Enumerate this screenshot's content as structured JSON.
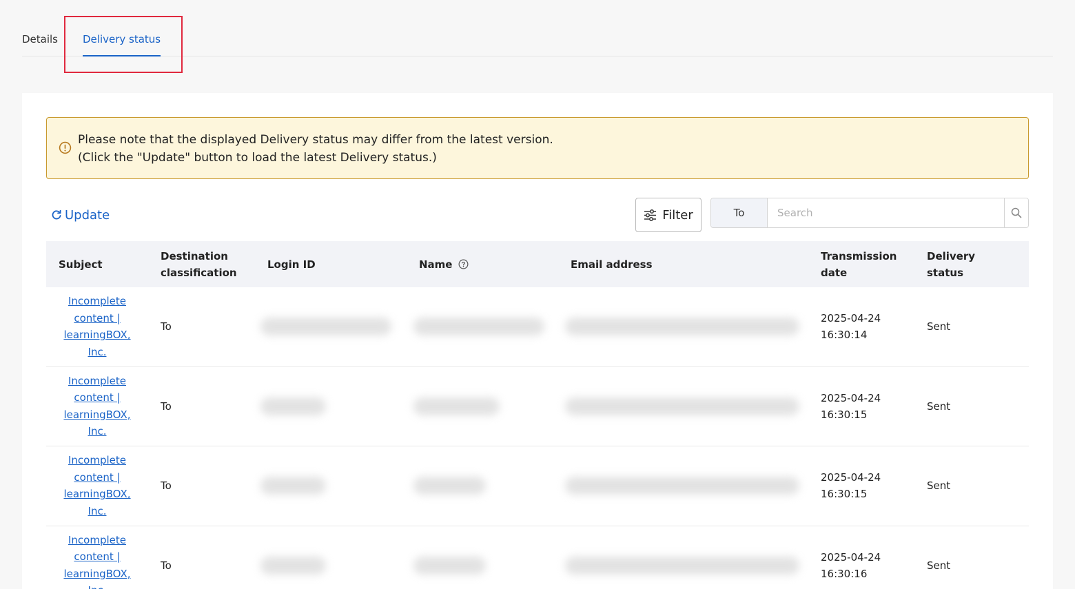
{
  "tabs": {
    "details": "Details",
    "delivery_status": "Delivery status"
  },
  "notice": {
    "line1": "Please note that the displayed Delivery status may differ from the latest version.",
    "line2": "(Click the \"Update\" button to load the latest Delivery status.)"
  },
  "toolbar": {
    "update_label": "Update",
    "filter_label": "Filter",
    "search_field": "To",
    "search_placeholder": "Search"
  },
  "table": {
    "headers": {
      "subject": "Subject",
      "destination_1": "Destination",
      "destination_2": "classification",
      "login_id": "Login ID",
      "name": "Name",
      "email": "Email address",
      "transmission_1": "Transmission",
      "transmission_2": "date",
      "status_1": "Delivery",
      "status_2": "status"
    },
    "rows": [
      {
        "subject": [
          "Incomplete",
          "content |",
          "learningBOX,",
          "Inc."
        ],
        "destination": "To",
        "date": "2025-04-24",
        "time": "16:30:14",
        "status": "Sent"
      },
      {
        "subject": [
          "Incomplete",
          "content |",
          "learningBOX,",
          "Inc."
        ],
        "destination": "To",
        "date": "2025-04-24",
        "time": "16:30:15",
        "status": "Sent"
      },
      {
        "subject": [
          "Incomplete",
          "content |",
          "learningBOX,",
          "Inc."
        ],
        "destination": "To",
        "date": "2025-04-24",
        "time": "16:30:15",
        "status": "Sent"
      },
      {
        "subject": [
          "Incomplete",
          "content |",
          "learningBOX,",
          "Inc."
        ],
        "destination": "To",
        "date": "2025-04-24",
        "time": "16:30:16",
        "status": "Sent"
      }
    ]
  },
  "colors": {
    "accent": "#1a63c7",
    "notice_bg": "#fdf6dc",
    "notice_border": "#c99a2e",
    "highlight": "#e0293e",
    "header_bg": "#f2f3f7"
  },
  "icons": {
    "notice": "warning-circle-icon",
    "update": "refresh-icon",
    "filter": "sliders-icon",
    "search": "search-icon",
    "help": "question-circle-icon"
  }
}
